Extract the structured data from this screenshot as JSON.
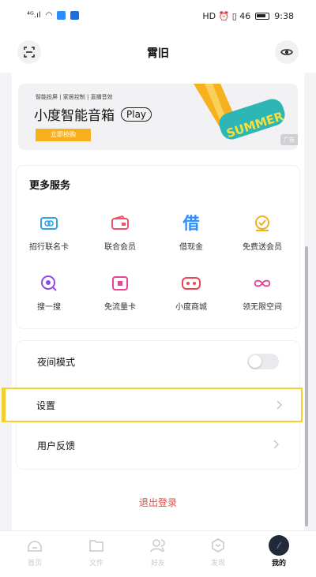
{
  "status_bar": {
    "left": "⁴ᴳ.ıl",
    "time": "9:38",
    "right_icons": "HD ⏰ ▯ 46"
  },
  "header": {
    "title": "霄旧"
  },
  "banner": {
    "tagline": "智能投屏 | 家居控制 | 直播音效",
    "product": "小度智能音箱",
    "pill": "Play",
    "buy_label": "立即抢购",
    "ad_label": "广告",
    "art_text": "SUMMER"
  },
  "services": {
    "title": "更多服务",
    "items": [
      {
        "label": "招行联名卡",
        "icon": "card-icon",
        "color": "#2aa4e6"
      },
      {
        "label": "联合会员",
        "icon": "wallet-icon",
        "color": "#ef5368"
      },
      {
        "label": "借现金",
        "icon": "borrow-icon",
        "color": "#2a8cff"
      },
      {
        "label": "免费送会员",
        "icon": "gift-icon",
        "color": "#f2b01e"
      },
      {
        "label": "搜一搜",
        "icon": "search-icon",
        "color": "#8b4ce6"
      },
      {
        "label": "免流量卡",
        "icon": "sim-icon",
        "color": "#e84393"
      },
      {
        "label": "小度商城",
        "icon": "store-icon",
        "color": "#ef4452"
      },
      {
        "label": "领无限空间",
        "icon": "infinity-icon",
        "color": "#e84393"
      }
    ]
  },
  "settings": {
    "night_mode": "夜间模式",
    "settings": "设置",
    "feedback": "用户反馈",
    "logout": "退出登录"
  },
  "tabs": [
    {
      "label": "首页",
      "icon": "home-icon"
    },
    {
      "label": "文件",
      "icon": "folder-icon"
    },
    {
      "label": "好友",
      "icon": "friends-icon"
    },
    {
      "label": "发现",
      "icon": "discover-icon"
    },
    {
      "label": "我的",
      "icon": "profile-avatar"
    }
  ]
}
